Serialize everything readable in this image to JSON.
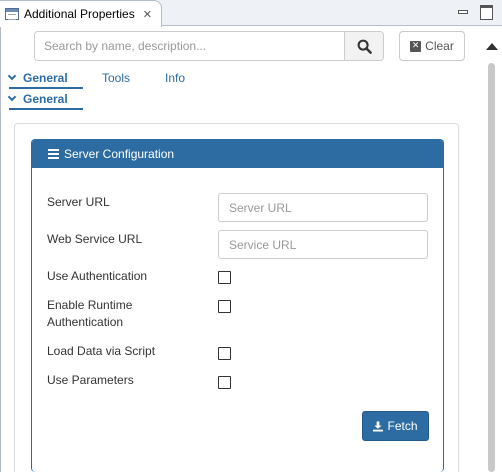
{
  "view": {
    "title": "Additional Properties",
    "close_glyph": "✕",
    "icon": "properties-view-icon"
  },
  "window_controls": {
    "minimize_icon": "minimize-icon",
    "maximize_icon": "maximize-icon"
  },
  "search": {
    "placeholder": "Search by name, description...",
    "value": "",
    "button_icon": "search-icon"
  },
  "clear_button": {
    "label": "Clear",
    "icon": "clear-x-icon"
  },
  "tabs": [
    {
      "label": "General",
      "active": true
    },
    {
      "label": "Tools",
      "active": false
    },
    {
      "label": "Info",
      "active": false
    }
  ],
  "subtab": {
    "label": "General"
  },
  "panel": {
    "title": "Server Configuration",
    "icon": "server-icon",
    "accent_color": "#2d6ca2",
    "fields": {
      "server_url": {
        "label": "Server URL",
        "placeholder": "Server URL",
        "value": ""
      },
      "web_service_url": {
        "label": "Web Service URL",
        "placeholder": "Service URL",
        "value": ""
      },
      "use_authentication": {
        "label": "Use Authentication",
        "checked": false
      },
      "enable_runtime_auth": {
        "label_line1": "Enable Runtime",
        "label_line2": "Authentication",
        "checked": false
      },
      "load_data_script": {
        "label": "Load Data via Script",
        "checked": false
      },
      "use_parameters": {
        "label": "Use Parameters",
        "checked": false
      }
    },
    "fetch_button": {
      "label": "Fetch",
      "icon": "download-icon"
    }
  }
}
